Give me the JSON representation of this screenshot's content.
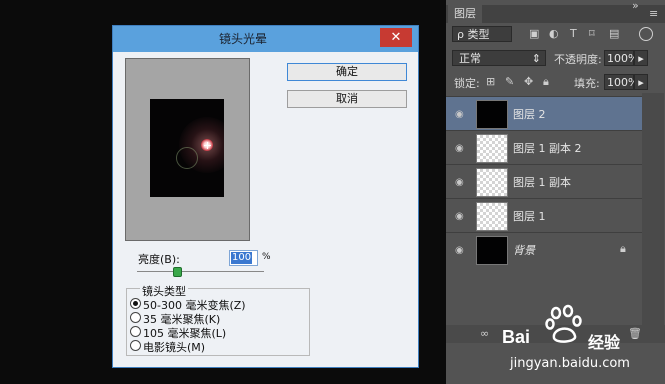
{
  "dialog": {
    "title": "镜头光晕",
    "close_glyph": "✕",
    "ok_label": "确定",
    "cancel_label": "取消",
    "brightness_label": "亮度(B):",
    "brightness_value": "100",
    "brightness_unit": "%",
    "lens_group_label": "镜头类型",
    "lens_options": [
      {
        "label": "50-300 毫米变焦(Z)",
        "selected": true
      },
      {
        "label": "35 毫米聚焦(K)",
        "selected": false
      },
      {
        "label": "105 毫米聚焦(L)",
        "selected": false
      },
      {
        "label": "电影镜头(M)",
        "selected": false
      }
    ]
  },
  "layers_panel": {
    "tab_label": "图层",
    "filter_label": "ρ 类型",
    "blend_mode": "正常",
    "opacity_label": "不透明度:",
    "opacity_value": "100%",
    "lock_label": "锁定:",
    "fill_label": "填充:",
    "fill_value": "100%",
    "layers": [
      {
        "name": "图层 2",
        "thumb": "black",
        "selected": true
      },
      {
        "name": "图层 1 副本 2",
        "thumb": "transparent",
        "selected": false
      },
      {
        "name": "图层 1 副本",
        "thumb": "transparent",
        "selected": false
      },
      {
        "name": "图层 1",
        "thumb": "transparent",
        "selected": false
      },
      {
        "name": "背景",
        "thumb": "black",
        "selected": false,
        "locked": true
      }
    ]
  },
  "watermark": {
    "brand": "Bai",
    "product": "经验",
    "url": "jingyan.baidu.com"
  },
  "colors": {
    "dialog_title_bar": "#5aa1dd",
    "close_button": "#c73a32",
    "selected_layer": "#5f7390",
    "panel_bg": "#535353"
  }
}
